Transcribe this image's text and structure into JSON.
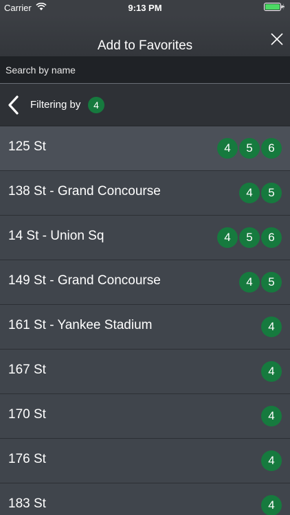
{
  "status_bar": {
    "carrier": "Carrier",
    "time": "9:13 PM"
  },
  "header": {
    "title": "Add to Favorites",
    "close_icon": "close-icon"
  },
  "search": {
    "placeholder": "Search by name",
    "value": ""
  },
  "filter": {
    "label": "Filtering by",
    "route": "4",
    "back_icon": "chevron-left-icon"
  },
  "colors": {
    "route_green": "#167a3e",
    "header_bg": "#3c3f44",
    "row_bg": "#40454c"
  },
  "stations": [
    {
      "name": "125 St",
      "routes": [
        "4",
        "5",
        "6"
      ]
    },
    {
      "name": "138 St - Grand Concourse",
      "routes": [
        "4",
        "5"
      ]
    },
    {
      "name": "14 St - Union Sq",
      "routes": [
        "4",
        "5",
        "6"
      ]
    },
    {
      "name": "149 St - Grand Concourse",
      "routes": [
        "4",
        "5"
      ]
    },
    {
      "name": "161 St - Yankee Stadium",
      "routes": [
        "4"
      ]
    },
    {
      "name": "167 St",
      "routes": [
        "4"
      ]
    },
    {
      "name": "170 St",
      "routes": [
        "4"
      ]
    },
    {
      "name": "176 St",
      "routes": [
        "4"
      ]
    },
    {
      "name": "183 St",
      "routes": [
        "4"
      ]
    }
  ]
}
